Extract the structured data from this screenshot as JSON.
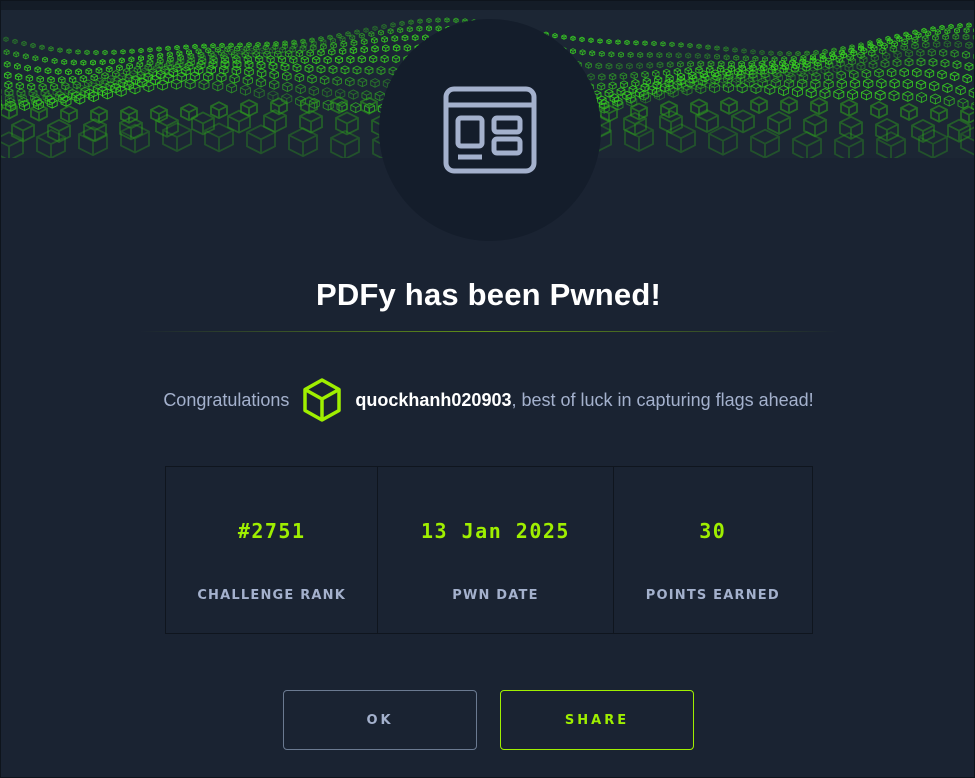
{
  "header": {
    "banner_icon": "matrix-cube-wave",
    "challenge_icon": "browser-window-icon"
  },
  "title": "PDFy has been Pwned!",
  "congrats": {
    "prefix": "Congratulations",
    "user_icon": "cube-icon",
    "username": "quockhanh020903",
    "suffix": ", best of luck in capturing flags ahead!"
  },
  "stats": [
    {
      "value": "#2751",
      "label": "CHALLENGE RANK"
    },
    {
      "value": "13 Jan 2025",
      "label": "PWN DATE"
    },
    {
      "value": "30",
      "label": "POINTS EARNED"
    }
  ],
  "buttons": {
    "ok_label": "OK",
    "share_label": "SHARE"
  },
  "colors": {
    "accent": "#9fef00",
    "background": "#1a2332",
    "text_muted": "#a4b1cd",
    "icon_circle": "#141d2b"
  }
}
